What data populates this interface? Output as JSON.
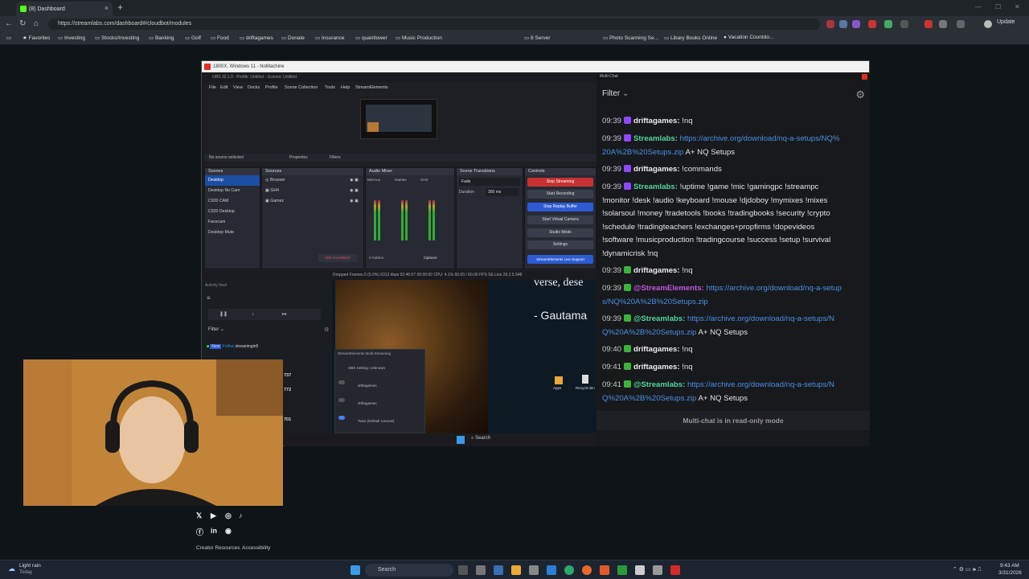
{
  "browser": {
    "tab_title": "(8) Dashboard",
    "url": "https://streamlabs.com/dashboard#/cloudbot/modules",
    "update_label": "Update",
    "bookmarks": [
      "Favorites",
      "Investing",
      "Stocks/Investing",
      "Banking",
      "Golf",
      "Food",
      "driftagames",
      "Donate",
      "Insurance",
      "quantlower",
      "Music Production",
      "8 Server",
      "Photo Scanning Se...",
      "Libary Books Online",
      "Vacation Countdo..."
    ]
  },
  "nomachine": {
    "title": "1800X, Windows 11 - NoMachine"
  },
  "obs": {
    "title": "OBS 32.1.0 - Profile: Untitled - Scenes: Untitled",
    "menu": [
      "File",
      "Edit",
      "View",
      "Docks",
      "Profile",
      "Scene Collection",
      "Tools",
      "Help",
      "StreamElements"
    ],
    "no_source": "No source selected",
    "properties": "Properties",
    "filters": "Filters",
    "docks": {
      "scenes": "Scenes",
      "sources": "Sources",
      "mixer": "Audio Mixer",
      "transitions": "Scene Transitions",
      "controls": "Controls"
    },
    "scenes": [
      "Desktop",
      "Desktop No Cam",
      "C920 CAM",
      "C920 Desktop",
      "Facecam",
      "Desktop Mute"
    ],
    "sources": [
      "Browser",
      "GH4",
      "Gamez"
    ],
    "mixer_channels": [
      "Mic/Aux",
      "Games",
      "GH4"
    ],
    "transition": "Fade",
    "duration_label": "Duration",
    "duration_value": "300 ms",
    "controls": [
      "Stop Streaming",
      "Start Recording",
      "Stop Replay Buffer",
      "Start Virtual Camera",
      "Studio Mode",
      "Settings",
      "StreamElements Live Support"
    ],
    "add_element": "ADD ELEMENT",
    "hidden": "0 hidden",
    "options": "Options",
    "status": "Dropped Frames 0 (0.0%)    6313 kbps    02:46:07    00:00:00    CPU: 4.1%    60.00 / 60.00 FPS    SE.Live 26.2.5.548"
  },
  "activity": {
    "title": "Activity feed",
    "filter": "Filter",
    "event_badge_new": "New",
    "event_badge_follow": "Follow",
    "event_user": "streamingin5",
    "numbers": [
      "737",
      "772",
      "701"
    ]
  },
  "se_multi": {
    "title": "StreamElements Multi-Streaming",
    "rows": [
      "OBS Setting: Unknown",
      "driftagames",
      "driftagames",
      "Twos (Default Canvas)"
    ]
  },
  "quote": {
    "line1": "verse, dese",
    "line2": "- Gautama"
  },
  "desktop_icons": [
    "Apps",
    "Recycle Bin"
  ],
  "multichat": {
    "window_title": "Multi-Chat",
    "filter_label": "Filter",
    "readonly": "Multi-chat is in read-only mode",
    "messages": [
      {
        "ts": "09:39",
        "badge": "tw",
        "user": "driftagames:",
        "text": " !nq",
        "link": "",
        "after": ""
      },
      {
        "ts": "09:39",
        "badge": "tw",
        "user": "Streamlabs:",
        "text": " ",
        "link": "https://archive.org/download/nq-a-setups/NQ%20A%2B%20Setups.zip",
        "after": " A+ NQ Setups"
      },
      {
        "ts": "09:39",
        "badge": "tw",
        "user": "driftagames:",
        "text": " !commands",
        "link": "",
        "after": ""
      },
      {
        "ts": "09:39",
        "badge": "tw",
        "user": "Streamlabs:",
        "text": " !uptime !game !mic !gamingpc !streampc !monitor !desk !audio !keyboard !mouse !djdoboy !mymixes !mixes !solarsoul !money !tradetools !books !tradingbooks !security !crypto !schedule !tradingteachers !exchanges+propfirms !dopevideos !software !musicproduction !tradingcourse !success !setup !survival !dynamicrisk !nq",
        "link": "",
        "after": ""
      },
      {
        "ts": "09:39",
        "badge": "kick",
        "user": "driftagames:",
        "text": " !nq",
        "link": "",
        "after": ""
      },
      {
        "ts": "09:39",
        "badge": "kick",
        "user": "@StreamElements:",
        "text": " ",
        "link": "https://archive.org/download/nq-a-setups/NQ%20A%2B%20Setups.zip",
        "after": ""
      },
      {
        "ts": "09:39",
        "badge": "kick",
        "user": "@Streamlabs:",
        "text": " ",
        "link": "https://archive.org/download/nq-a-setups/NQ%20A%2B%20Setups.zip",
        "after": " A+ NQ Setups"
      },
      {
        "ts": "09:40",
        "badge": "kick",
        "user": "driftagames:",
        "text": " !nq",
        "link": "",
        "after": ""
      },
      {
        "ts": "09:41",
        "badge": "kick",
        "user": "driftagames:",
        "text": " !nq",
        "link": "",
        "after": ""
      },
      {
        "ts": "09:41",
        "badge": "kick",
        "user": "@Streamlabs:",
        "text": " ",
        "link": "https://archive.org/download/nq-a-setups/NQ%20A%2B%20Setups.zip",
        "after": " A+ NQ Setups"
      }
    ]
  },
  "remote_taskbar": {
    "search": "Search",
    "time": "9:43 AM",
    "date": "3/31/2026"
  },
  "footer": {
    "creator_resources": "Creator Resources",
    "accessibility": "Accessibility"
  },
  "taskbar": {
    "weather_title": "Light rain",
    "weather_sub": "Today",
    "search": "Search",
    "time": "9:43 AM",
    "date": "3/31/2026"
  },
  "colors": {
    "twitch": "#9146ff",
    "kick": "#3bb33b",
    "streamlabs_name": "#53d6a0",
    "streamelements_name": "#c455e0",
    "link": "#4a90e2"
  }
}
